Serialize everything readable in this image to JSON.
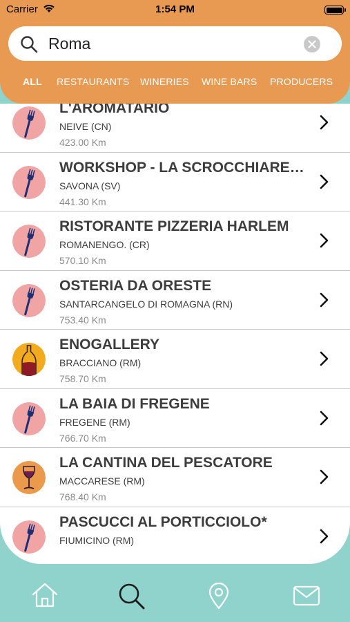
{
  "status_bar": {
    "carrier": "Carrier",
    "time": "1:54 PM"
  },
  "search": {
    "query": "Roma",
    "icon": "search-icon",
    "clear_icon": "clear-icon"
  },
  "tabs": [
    {
      "label": "ALL",
      "active": true
    },
    {
      "label": "RESTAURANTS",
      "active": false
    },
    {
      "label": "WINERIES",
      "active": false
    },
    {
      "label": "WINE BARS",
      "active": false
    },
    {
      "label": "PRODUCERS",
      "active": false
    }
  ],
  "results": [
    {
      "name": "L'AROMATARIO",
      "place": "NEIVE (CN)",
      "distance": "423.00 Km",
      "icon": "fork-icon"
    },
    {
      "name": "WORKSHOP - LA SCROCCHIARELLA",
      "place": "SAVONA (SV)",
      "distance": "441.30 Km",
      "icon": "fork-icon"
    },
    {
      "name": "RISTORANTE PIZZERIA HARLEM",
      "place": "ROMANENGO. (CR)",
      "distance": "570.10 Km",
      "icon": "fork-icon"
    },
    {
      "name": "OSTERIA DA ORESTE",
      "place": "SANTARCANGELO DI ROMAGNA (RN)",
      "distance": "753.40 Km",
      "icon": "fork-icon"
    },
    {
      "name": "ENOGALLERY",
      "place": "BRACCIANO (RM)",
      "distance": "758.70 Km",
      "icon": "wine-bottle-icon"
    },
    {
      "name": "LA BAIA DI FREGENE",
      "place": "FREGENE (RM)",
      "distance": "766.70 Km",
      "icon": "fork-icon"
    },
    {
      "name": "LA CANTINA DEL PESCATORE",
      "place": "MACCARESE (RM)",
      "distance": "768.40 Km",
      "icon": "wine-glass-icon"
    },
    {
      "name": "PASCUCCI AL PORTICCIOLO*",
      "place": "FIUMICINO (RM)",
      "distance": "",
      "icon": "fork-icon"
    }
  ],
  "tab_bar": [
    {
      "name": "home-icon",
      "active": false
    },
    {
      "name": "search-icon",
      "active": true
    },
    {
      "name": "map-pin-icon",
      "active": false
    },
    {
      "name": "mail-icon",
      "active": false
    }
  ],
  "colors": {
    "accent": "#e89a52",
    "background": "#8fd3cc",
    "restaurant_circle": "#f1a4a4",
    "winery_circle": "#f2ab1e",
    "winebar_circle": "#eb9a4c",
    "icon_navy": "#1e2f74",
    "text_dark": "#3d3d3d",
    "text_gray": "#8a8a8a"
  }
}
